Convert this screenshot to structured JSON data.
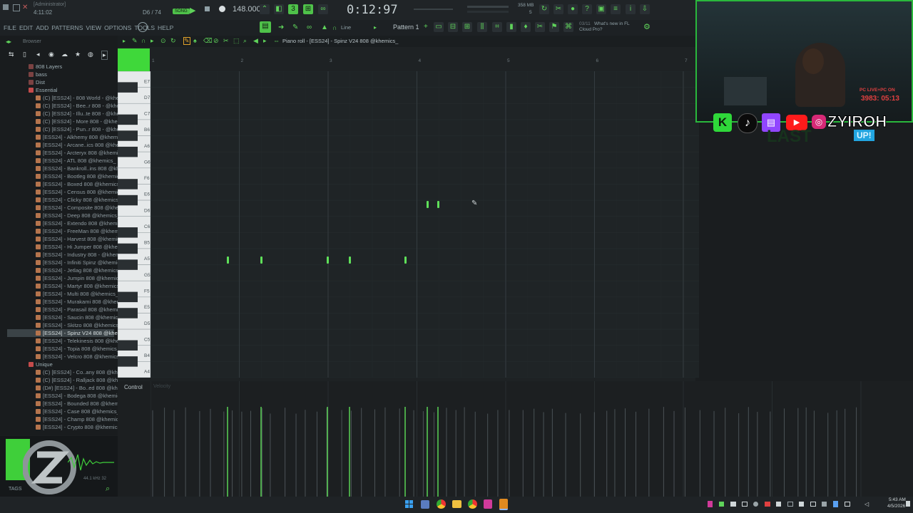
{
  "titlebar": {
    "admin": "[Administrator]",
    "position": "4:11:02",
    "pattern_counter": "D6 / 74",
    "song_label": "SONG",
    "tempo": "148.000",
    "time": "0:12:97",
    "memory": "358 MB",
    "voices": "5"
  },
  "menu": [
    "FILE",
    "EDIT",
    "ADD",
    "PATTERNS",
    "VIEW",
    "OPTIONS",
    "TOOLS",
    "HELP"
  ],
  "toolbar": {
    "pattern": "Pattern 1",
    "snap": "Line",
    "news_date": "03/11",
    "news": "What's new in FL",
    "news2": "Cloud Pro?"
  },
  "browser": {
    "title": "Browser",
    "items": [
      {
        "label": "808 Layers",
        "type": "folder"
      },
      {
        "label": "bass",
        "type": "folder"
      },
      {
        "label": "Dist",
        "type": "folder"
      },
      {
        "label": "Essential",
        "type": "folder-open"
      },
      {
        "label": "(C) [ESS24] - 808 World - @khemics_",
        "type": "file"
      },
      {
        "label": "(C) [ESS24] - Bee..r 808 - @khemics_",
        "type": "file"
      },
      {
        "label": "(C) [ESS24] - Illu..te 808 - @khemics_",
        "type": "file"
      },
      {
        "label": "(C) [ESS24] - More 808 - @khemics_",
        "type": "file"
      },
      {
        "label": "(C) [ESS24] - Pun..r 808 - @khemics_",
        "type": "file"
      },
      {
        "label": "[ESS24] - Alkhemy 808 @khemics_",
        "type": "file"
      },
      {
        "label": "[ESS24] - Arcane..ics 808 @khemics_",
        "type": "file"
      },
      {
        "label": "[ESS24] - Arcteryx 808 @khemics_",
        "type": "file"
      },
      {
        "label": "[ESS24] - ATL 808 @khemics_",
        "type": "file"
      },
      {
        "label": "[ESS24] - Bankroll..ins 808 @khemics_",
        "type": "file"
      },
      {
        "label": "[ESS24] - Bootleg 808 @khemics_",
        "type": "file"
      },
      {
        "label": "[ESS24] - Boxed 808 @khemics_",
        "type": "file"
      },
      {
        "label": "[ESS24] - Census 808 @khemics_",
        "type": "file"
      },
      {
        "label": "[ESS24] - Clicky 808 @khemics_",
        "type": "file"
      },
      {
        "label": "[ESS24] - Composite 808 @khemics_",
        "type": "file"
      },
      {
        "label": "[ESS24] - Deep 808 @khemics_",
        "type": "file"
      },
      {
        "label": "[ESS24] - Extendo 808 @khemics_",
        "type": "file"
      },
      {
        "label": "[ESS24] - FreeMan 808 @khemics_",
        "type": "file"
      },
      {
        "label": "[ESS24] - Harvest 808 @khemics_",
        "type": "file"
      },
      {
        "label": "[ESS24] - Hi Jumper 808 @khemics_",
        "type": "file"
      },
      {
        "label": "[ESS24] - Industry 808 - @khemics_",
        "type": "file"
      },
      {
        "label": "[ESS24] - Infiniti Spinz @khemics_",
        "type": "file"
      },
      {
        "label": "[ESS24] - Jetlag 808 @khemics_",
        "type": "file"
      },
      {
        "label": "[ESS24] - Jumpin 808 @khemics_",
        "type": "file"
      },
      {
        "label": "[ESS24] - Martyr 808 @khemics_",
        "type": "file"
      },
      {
        "label": "[ESS24] - Multi 808 @khemics_",
        "type": "file"
      },
      {
        "label": "[ESS24] - Murakami 808 @khemics_",
        "type": "file"
      },
      {
        "label": "[ESS24] - Parasail 808 @khemics_",
        "type": "file"
      },
      {
        "label": "[ESS24] - Saucin 808 @khemics_",
        "type": "file"
      },
      {
        "label": "[ESS24] - Skitzo 808 @khemics_",
        "type": "file"
      },
      {
        "label": "[ESS24] - Spinz V24 808 @khemics_",
        "type": "file",
        "selected": true
      },
      {
        "label": "[ESS24] - Telekinesis 808 @khemics_",
        "type": "file"
      },
      {
        "label": "[ESS24] - Topia 808 @khemics_",
        "type": "file"
      },
      {
        "label": "[ESS24] - Velcro 808 @khemics_",
        "type": "file"
      },
      {
        "label": "Unique",
        "type": "folder-open"
      },
      {
        "label": "(C) [ESS24] - Co..any 808 @khemics_",
        "type": "file"
      },
      {
        "label": "(C) [ESS24] - Ralljack 808 @khemics_",
        "type": "file"
      },
      {
        "label": "(D#) [ESS24] - Bo..ed 808 @khemics_",
        "type": "file"
      },
      {
        "label": "[ESS24] - Bodega 808 @khemics_",
        "type": "file"
      },
      {
        "label": "[ESS24] - Bounded 808 @khemics_",
        "type": "file"
      },
      {
        "label": "[ESS24] - Case 808 @khemics_",
        "type": "file"
      },
      {
        "label": "[ESS24] - Champ 808 @khemics_",
        "type": "file"
      },
      {
        "label": "[ESS24] - Crypto 808 @khemics_",
        "type": "file"
      }
    ],
    "tags": "TAGS",
    "sample_info": "44.1 kHz 32"
  },
  "pianoroll": {
    "title": "Piano roll - [ESS24] - Spinz V24 808 @khemics_",
    "bar_numbers": [
      "1",
      "2",
      "3",
      "4",
      "5",
      "6",
      "7"
    ],
    "keys": [
      "E7",
      "D7",
      "C7",
      "B6",
      "A6",
      "G6",
      "F6",
      "E6",
      "D6",
      "C6",
      "B5",
      "A5",
      "G5",
      "F5",
      "E5",
      "D5",
      "C5",
      "B4",
      "A4"
    ],
    "control_label": "Control",
    "control_sub": "Velocity",
    "accent": "#5fe05a"
  },
  "webcam": {
    "brand": "ZYIROH",
    "live": "PC LIVE+PC ON",
    "timer": "3983: 05:13",
    "bg_text": "LAST",
    "bg_text2": "UP!"
  },
  "taskbar": {
    "time": "5:43 AM",
    "date": "4/5/2026"
  }
}
